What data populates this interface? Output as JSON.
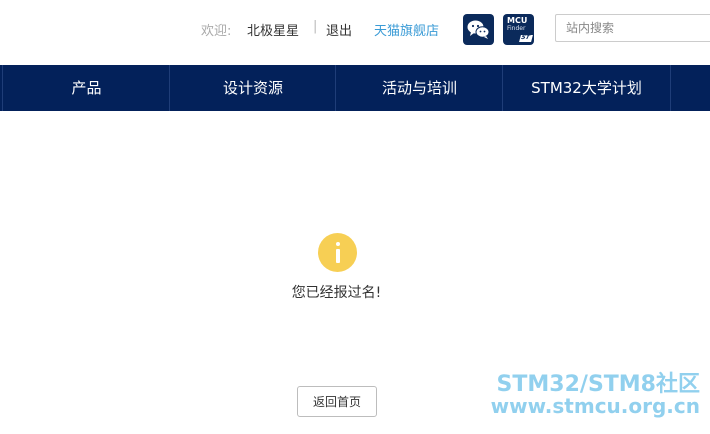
{
  "header": {
    "welcome_label": "欢迎:",
    "username": "北极星星",
    "separator": "|",
    "logout_label": "退出",
    "tmall_store_label": "天猫旗舰店",
    "mcu_finder": {
      "line1": "MCU",
      "line2": "Finder",
      "brand": "ST"
    },
    "search": {
      "placeholder": "站内搜索",
      "value": ""
    }
  },
  "nav": {
    "items": [
      {
        "label": "产品"
      },
      {
        "label": "设计资源"
      },
      {
        "label": "活动与培训"
      },
      {
        "label": "STM32大学计划"
      }
    ]
  },
  "main": {
    "message": "您已经报过名!",
    "home_button_label": "返回首页"
  },
  "watermark": {
    "line1": "STM32/STM8社区",
    "line2": "www.stmcu.org.cn"
  },
  "colors": {
    "nav_bg": "#03215a",
    "icon_bg": "#0b2a5b",
    "accent_link": "#3a9bd6",
    "alert_yellow": "#f7cf54",
    "watermark": "#7ec8ec"
  },
  "icons": {
    "wechat": "wechat-icon",
    "mcu_finder": "mcu-finder-icon",
    "alert": "info-alert-icon"
  }
}
